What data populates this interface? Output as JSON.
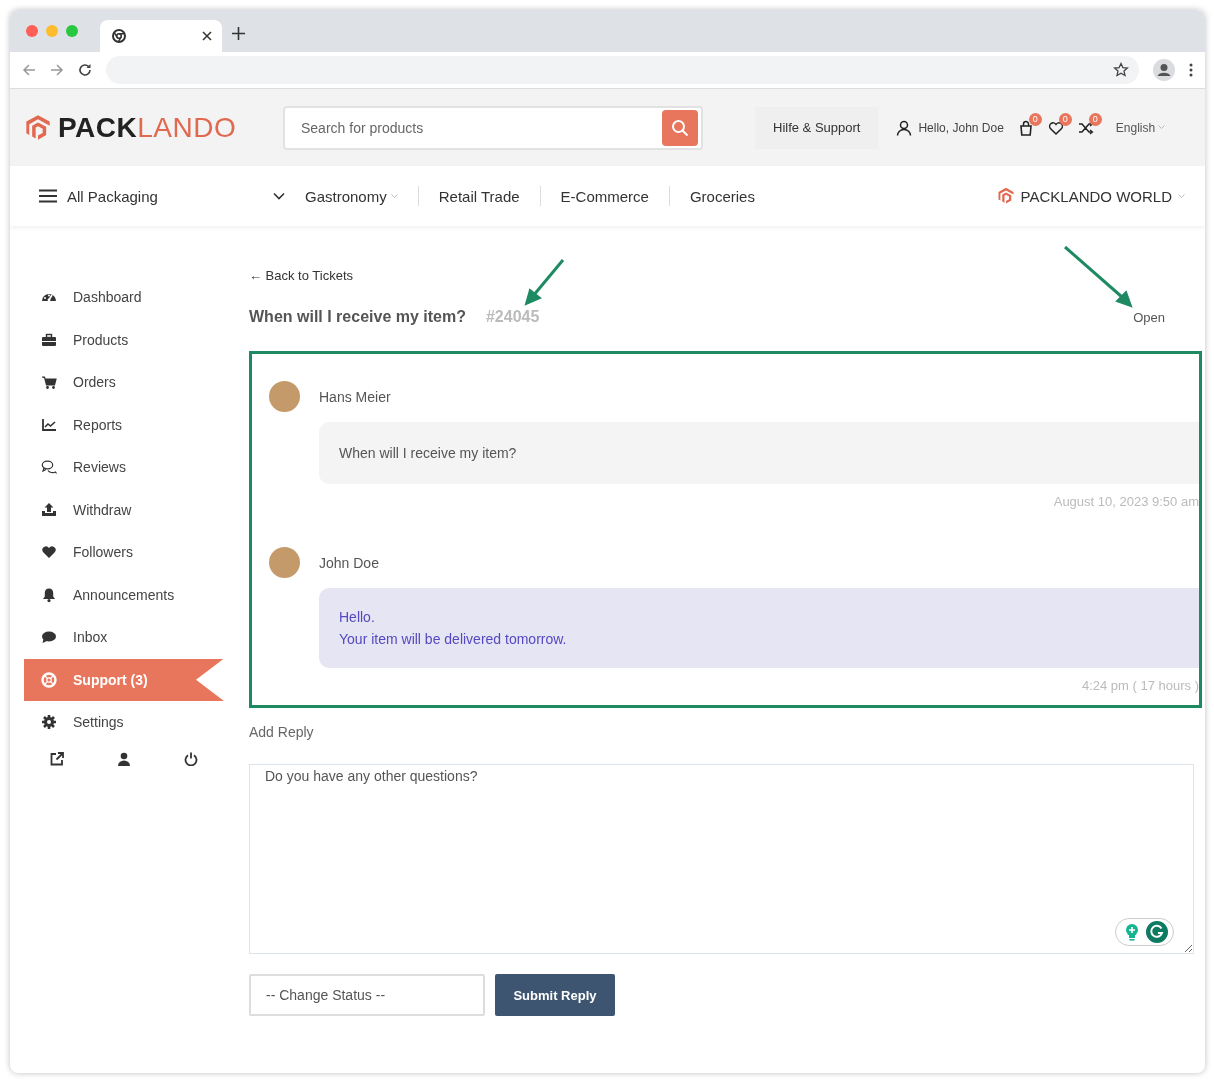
{
  "header": {
    "logo": {
      "text_dark": "PACK",
      "text_accent": "LANDO"
    },
    "search": {
      "placeholder": "Search for products"
    },
    "help_button": "Hilfe & Support",
    "greeting": "Hello, John Doe",
    "counters": [
      "0",
      "0",
      "0"
    ],
    "language": "English"
  },
  "nav": {
    "all_packaging": "All Packaging",
    "items": [
      {
        "label": "Gastronomy",
        "dropdown": true
      },
      {
        "label": "Retail Trade",
        "dropdown": false
      },
      {
        "label": "E-Commerce",
        "dropdown": false
      },
      {
        "label": "Groceries",
        "dropdown": false
      }
    ],
    "world": "PACKLANDO WORLD"
  },
  "sidebar": {
    "items": [
      {
        "label": "Dashboard",
        "selected": false
      },
      {
        "label": "Products",
        "selected": false
      },
      {
        "label": "Orders",
        "selected": false
      },
      {
        "label": "Reports",
        "selected": false
      },
      {
        "label": "Reviews",
        "selected": false
      },
      {
        "label": "Withdraw",
        "selected": false
      },
      {
        "label": "Followers",
        "selected": false
      },
      {
        "label": "Announcements",
        "selected": false
      },
      {
        "label": "Inbox",
        "selected": false
      },
      {
        "label": "Support (3)",
        "selected": true
      },
      {
        "label": "Settings",
        "selected": false
      }
    ]
  },
  "ticket": {
    "back_link": "← Back to Tickets",
    "title": "When will I receive my item?",
    "number": "#24045",
    "status": "Open"
  },
  "messages": [
    {
      "author": "Hans Meier",
      "kind": "incoming",
      "lines": [
        "When will I receive my item?"
      ],
      "time": "August 10, 2023 9:50 am"
    },
    {
      "author": "John Doe",
      "kind": "outgoing",
      "lines": [
        "Hello.",
        "Your item will be delivered tomorrow."
      ],
      "time": "4:24 pm ( 17 hours )"
    }
  ],
  "reply": {
    "label": "Add Reply",
    "value": "Do you have any other questions?",
    "status_select": "-- Change Status --",
    "submit": "Submit Reply"
  }
}
